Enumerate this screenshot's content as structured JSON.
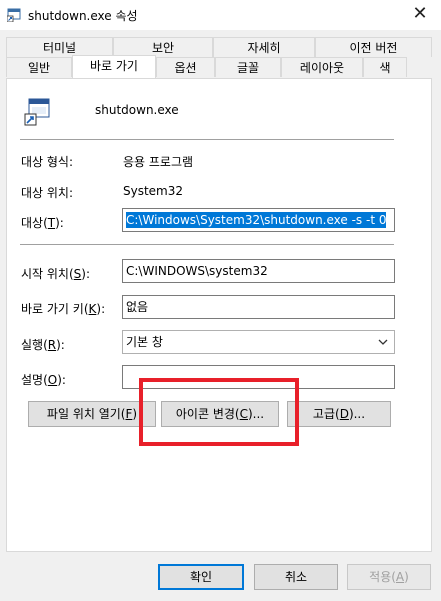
{
  "window": {
    "title": "shutdown.exe 속성",
    "close_glyph": "✕"
  },
  "tabs": {
    "row1": [
      "터미널",
      "보안",
      "자세히",
      "이전 버전"
    ],
    "row2": [
      "일반",
      "바로 가기",
      "옵션",
      "글꼴",
      "레이아웃",
      "색"
    ],
    "active": "바로 가기"
  },
  "shortcut": {
    "name": "shutdown.exe",
    "target_type_label": "대상 형식:",
    "target_type_value": "응용 프로그램",
    "target_location_label": "대상 위치:",
    "target_location_value": "System32",
    "target_label_pre": "대상(",
    "target_label_key": "T",
    "target_label_post": "):",
    "target_value": "C:\\Windows\\System32\\shutdown.exe -s -t 0",
    "start_in_label_pre": "시작 위치(",
    "start_in_label_key": "S",
    "start_in_label_post": "):",
    "start_in_value": "C:\\WINDOWS\\system32",
    "shortcut_key_label_pre": "바로 가기 키(",
    "shortcut_key_label_key": "K",
    "shortcut_key_label_post": "):",
    "shortcut_key_value": "없음",
    "run_label_pre": "실행(",
    "run_label_key": "R",
    "run_label_post": "):",
    "run_value": "기본 창",
    "comment_label_pre": "설명(",
    "comment_label_key": "O",
    "comment_label_post": "):",
    "comment_value": ""
  },
  "buttons": {
    "open_location_pre": "파일 위치 열기(",
    "open_location_key": "F",
    "open_location_post": ")",
    "change_icon_pre": "아이콘 변경(",
    "change_icon_key": "C",
    "change_icon_post": ")...",
    "advanced_pre": "고급(",
    "advanced_key": "D",
    "advanced_post": ")...",
    "ok": "확인",
    "cancel": "취소",
    "apply_pre": "적용(",
    "apply_key": "A",
    "apply_post": ")"
  },
  "annotation": {
    "highlight_color": "#e8202a"
  },
  "colors": {
    "selection": "#0078d7",
    "dialog_bg": "#f0f0f0"
  }
}
